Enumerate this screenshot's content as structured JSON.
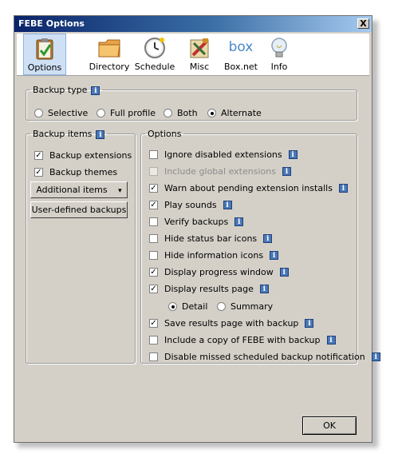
{
  "window": {
    "title": "FEBE Options",
    "close_label": "X"
  },
  "toolbar": {
    "items": [
      {
        "label": "Options",
        "icon": "clipboard-check-icon",
        "selected": true
      },
      {
        "label": "Directory",
        "icon": "folder-icon"
      },
      {
        "label": "Schedule",
        "icon": "clock-icon"
      },
      {
        "label": "Misc",
        "icon": "tools-icon"
      },
      {
        "label": "Box.net",
        "icon": "box-logo-icon",
        "logo_text": "box"
      },
      {
        "label": "Info",
        "icon": "lightbulb-icon"
      }
    ]
  },
  "backup_type": {
    "legend": "Backup type",
    "options": [
      {
        "label": "Selective",
        "selected": false
      },
      {
        "label": "Full profile",
        "selected": false
      },
      {
        "label": "Both",
        "selected": false
      },
      {
        "label": "Alternate",
        "selected": true
      }
    ]
  },
  "backup_items": {
    "legend": "Backup items",
    "extensions": {
      "label": "Backup extensions",
      "checked": true
    },
    "themes": {
      "label": "Backup themes",
      "checked": true
    },
    "additional_label": "Additional items",
    "additional_arrow": "▾",
    "user_defined_label": "User-defined backups"
  },
  "options": {
    "legend": "Options",
    "items": [
      {
        "label": "Ignore disabled extensions",
        "checked": false,
        "info": true
      },
      {
        "label": "Include global extensions",
        "checked": false,
        "info": true,
        "disabled": true
      },
      {
        "label": "Warn about pending extension installs",
        "checked": true,
        "info": true
      },
      {
        "label": "Play sounds",
        "checked": true,
        "info": true
      },
      {
        "label": "Verify backups",
        "checked": false,
        "info": true
      },
      {
        "label": "Hide status bar icons",
        "checked": false,
        "info": true
      },
      {
        "label": "Hide information icons",
        "checked": false,
        "info": true
      },
      {
        "label": "Display progress window",
        "checked": true,
        "info": true
      },
      {
        "label": "Display results page",
        "checked": true,
        "info": true
      }
    ],
    "results_mode": [
      {
        "label": "Detail",
        "selected": true
      },
      {
        "label": "Summary",
        "selected": false
      }
    ],
    "items2": [
      {
        "label": "Save results page with backup",
        "checked": true,
        "info": true
      },
      {
        "label": "Include a copy of FEBE with backup",
        "checked": false,
        "info": true
      },
      {
        "label": "Disable missed scheduled backup notification",
        "checked": false,
        "info": true
      }
    ]
  },
  "info_glyph": "i",
  "check_glyph": "✓",
  "ok_label": "OK",
  "colors": {
    "title_start": "#0a246a",
    "title_end": "#a6caf0",
    "dialog_bg": "#d4d0c8",
    "info_blue": "#4a78b8"
  }
}
